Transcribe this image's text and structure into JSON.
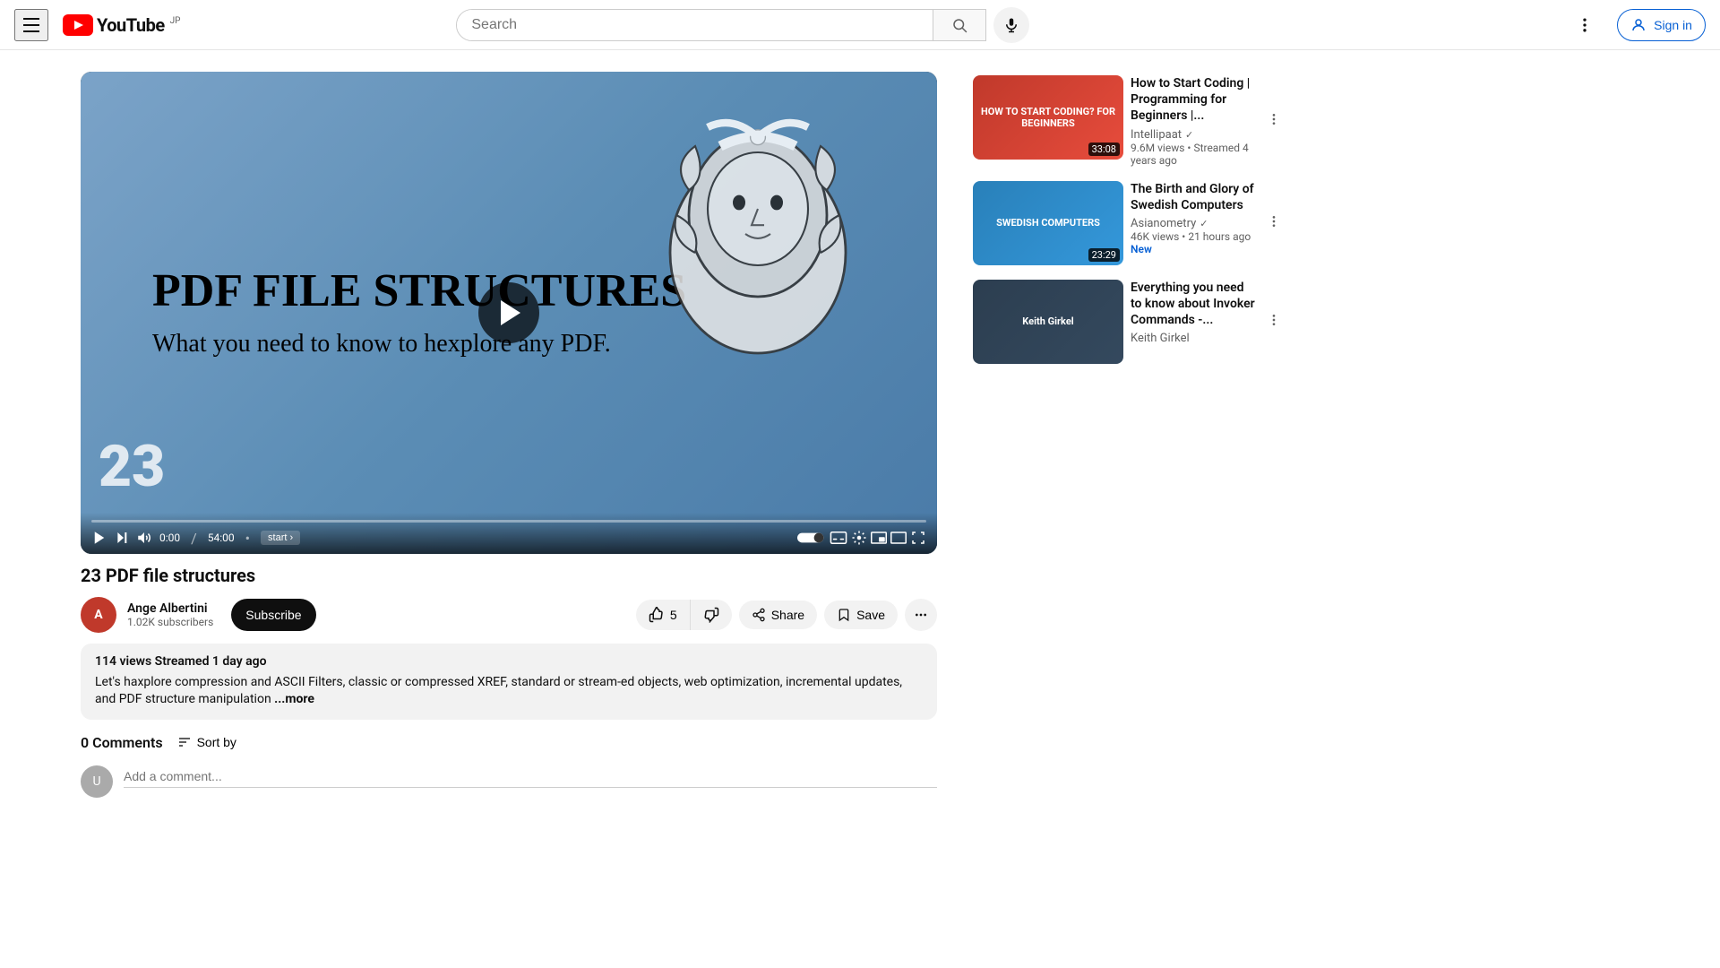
{
  "header": {
    "logo_text": "YouTube",
    "logo_jp": "JP",
    "search_placeholder": "Search",
    "search_value": "",
    "sign_in_label": "Sign in"
  },
  "video": {
    "chapter_number": "23",
    "title_overlay": "PDF FILE STRUCTURES",
    "subtitle_overlay": "What you need to know to hexplore any PDF.",
    "time_current": "0:00",
    "time_total": "54:00",
    "start_label": "start",
    "main_title": "23 PDF file structures",
    "channel_name": "Ange Albertini",
    "channel_avatar_letter": "A",
    "subscriber_count": "1.02K subscribers",
    "subscribe_label": "Subscribe",
    "like_count": "5",
    "like_label": "5",
    "share_label": "Share",
    "save_label": "Save",
    "stats": "114 views  Streamed 1 day ago",
    "description": "Let's haxplore compression and ASCII Filters, classic or compressed XREF, standard or stream-ed objects, web optimization, incremental updates, and PDF structure manipulation",
    "description_more": "...more"
  },
  "comments": {
    "count_label": "0 Comments",
    "sort_label": "Sort by",
    "placeholder": "Add a comment..."
  },
  "sidebar": {
    "items": [
      {
        "title": "How to Start Coding | Programming for Beginners |...",
        "channel": "Intellipaat",
        "verified": true,
        "views": "9.6M views",
        "time_ago": "Streamed 4 years ago",
        "duration": "33:08",
        "thumb_style": "thumb-red",
        "thumb_text": "HOW TO START CODING? FOR BEGINNERS"
      },
      {
        "title": "The Birth and Glory of Swedish Computers",
        "channel": "Asianometry",
        "verified": true,
        "views": "46K views",
        "time_ago": "21 hours ago",
        "duration": "23:29",
        "thumb_style": "thumb-blue",
        "thumb_text": "SWEDISH COMPUTERS",
        "is_new": true
      },
      {
        "title": "Everything you need to know about Invoker Commands -...",
        "channel": "Keith Girkel",
        "verified": false,
        "views": "",
        "time_ago": "",
        "duration": "",
        "thumb_style": "thumb-dark",
        "thumb_text": "Keith Girkel"
      }
    ]
  }
}
